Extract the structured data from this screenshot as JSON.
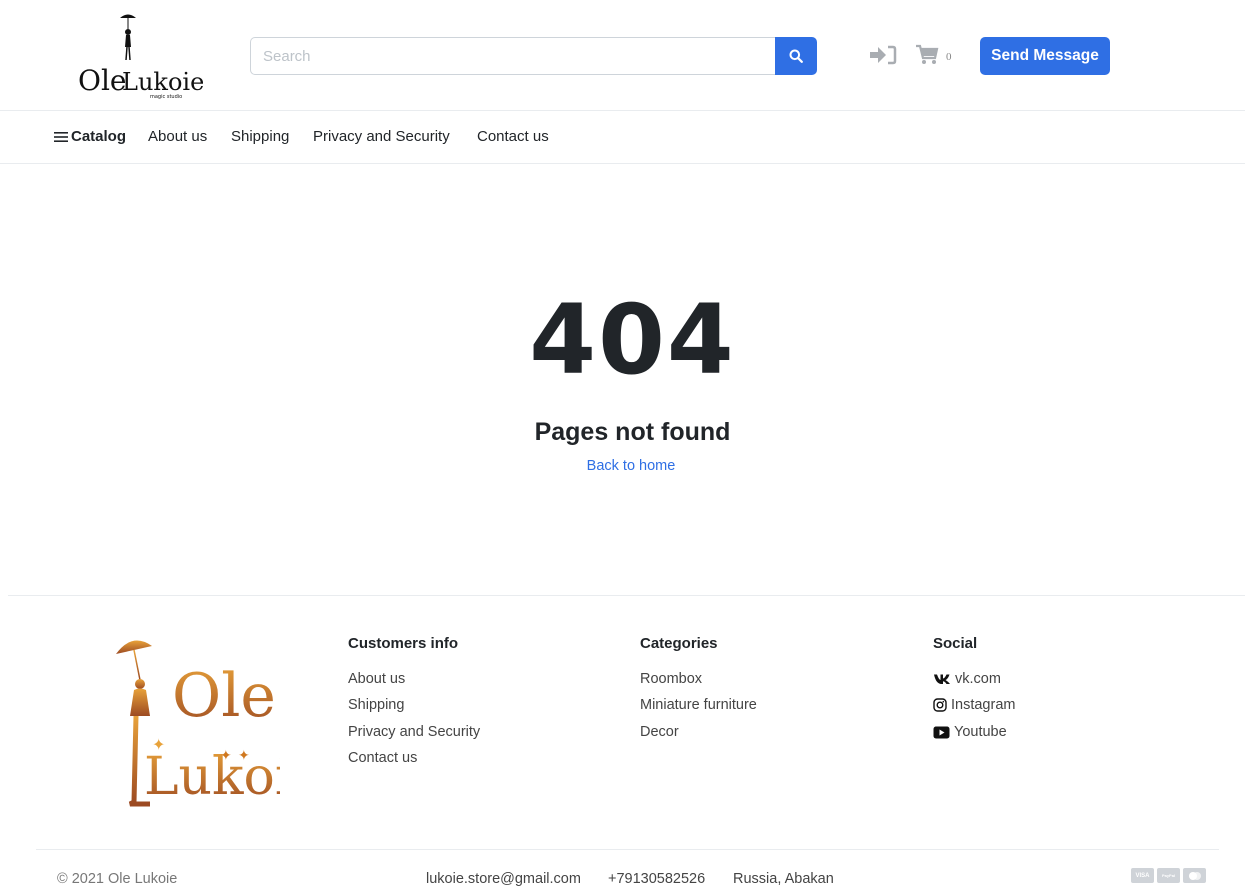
{
  "brand": {
    "logo_text_line1": "Ole",
    "logo_text_line2": "Lukoie",
    "logo_tagline": "magic studio"
  },
  "header": {
    "search_placeholder": "Search",
    "cart_count": "0",
    "send_message_label": "Send Message",
    "icons": [
      "search-icon",
      "login-icon",
      "cart-icon"
    ]
  },
  "nav": {
    "catalog_label": "Catalog",
    "links": [
      "About us",
      "Shipping",
      "Privacy and Security",
      "Contact us"
    ]
  },
  "main": {
    "error_code": "404",
    "title": "Pages not found",
    "back_link": "Back to home"
  },
  "footer": {
    "customers_info": {
      "title": "Customers info",
      "items": [
        "About us",
        "Shipping",
        "Privacy and Security",
        "Contact us"
      ]
    },
    "categories": {
      "title": "Categories",
      "items": [
        "Roombox",
        "Miniature furniture",
        "Decor"
      ]
    },
    "social": {
      "title": "Social",
      "items": [
        "vk.com",
        "Instagram",
        "Youtube"
      ]
    },
    "copyright": "© 2021 Ole Lukoie",
    "email": "lukoie.store@gmail.com",
    "phone": "+79130582526",
    "location": "Russia, Abakan",
    "payment_labels": [
      "VISA",
      "PayPal",
      "mastercard"
    ]
  },
  "colors": {
    "accent": "#2f6fe4",
    "text": "#212529",
    "logo_gradient_top": "#e8a23a",
    "logo_gradient_bottom": "#9c4a22"
  }
}
